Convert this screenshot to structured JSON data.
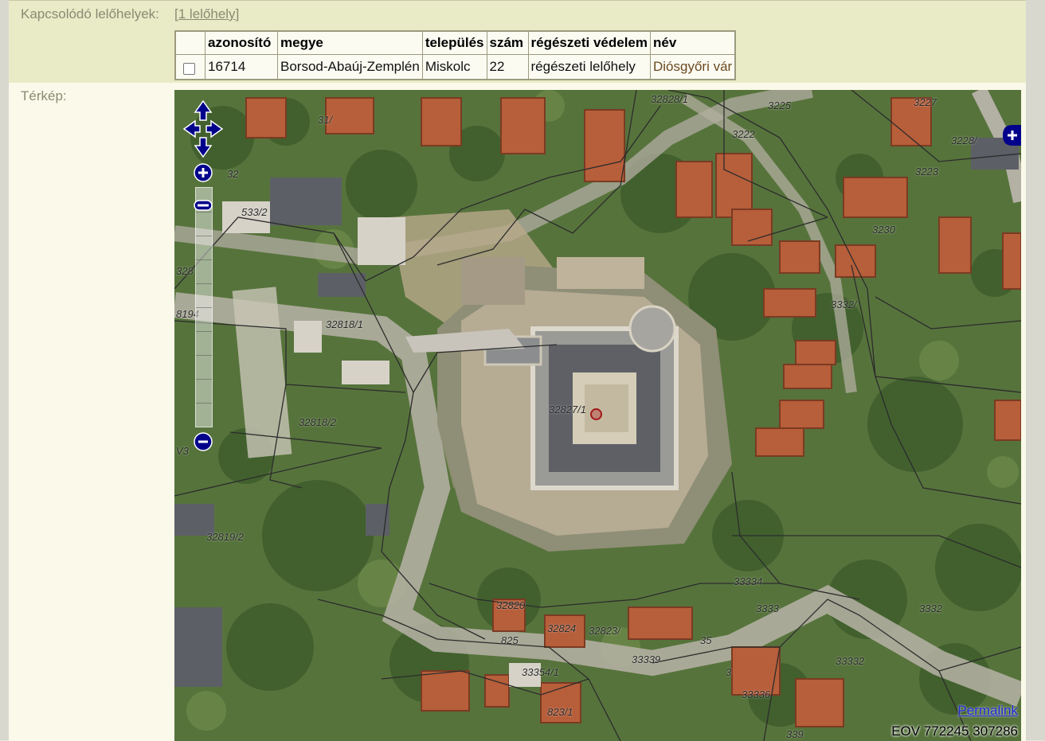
{
  "related_sites": {
    "label": "Kapcsolódó lelőhelyek:",
    "link_prefix": "[",
    "link_text": "1 lelőhely",
    "link_suffix": "]",
    "columns": [
      "azonosító",
      "megye",
      "település",
      "szám",
      "régészeti védelem",
      "név"
    ],
    "rows": [
      {
        "azonosito": "16714",
        "megye": "Borsod-Abaúj-Zemplén",
        "telepules": "Miskolc",
        "szam": "22",
        "vedelem": "régészeti lelőhely",
        "nev": "Diósgyőri vár"
      }
    ]
  },
  "map": {
    "label": "Térkép:",
    "permalink": "Permalink",
    "coords": "EOV 772245 307286",
    "parcel_labels": [
      "32828/1",
      "31/",
      "3225",
      "3222",
      "3227",
      "3228/",
      "3223",
      "32",
      "533/2",
      "3230",
      "328",
      "32818/1",
      "8194",
      "3332/",
      "32827/1",
      "32818/2",
      "V3",
      "32819/2",
      "33334",
      "3333",
      "3332",
      "32823/",
      "32824",
      "825",
      "35",
      "33339",
      "33354/1",
      "33336",
      "3",
      "823/1",
      "339",
      "32820",
      "33332"
    ],
    "icons": {
      "pan": "pan-arrows-icon",
      "zoom_in": "zoom-in-icon",
      "zoom_out": "zoom-out-icon",
      "layers": "layer-switcher-icon",
      "marker": "site-marker-icon"
    },
    "colors": {
      "control": "#00008b",
      "marker": "#a3181a"
    }
  }
}
